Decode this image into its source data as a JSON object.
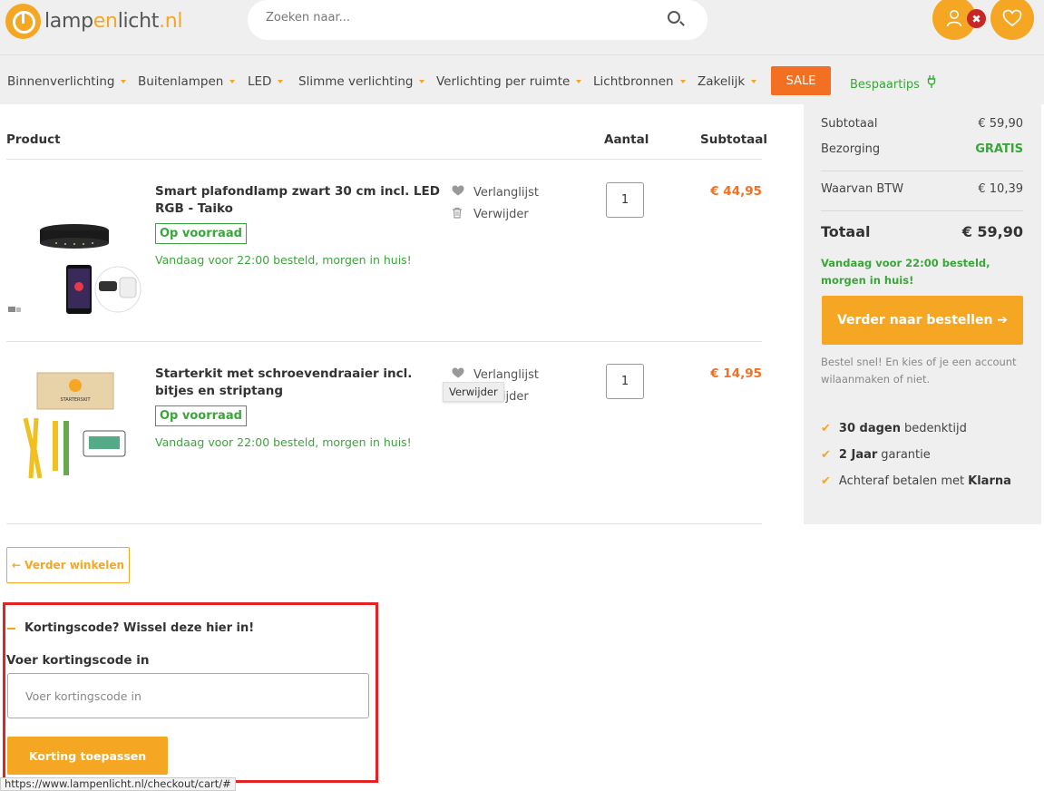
{
  "header": {
    "logo_pre": "lamp",
    "logo_mid": "en",
    "logo_post": "licht",
    "logo_tld": ".nl",
    "search_placeholder": "Zoeken naar...",
    "account_badge": "✖"
  },
  "nav": {
    "items": [
      "Binnenverlichting",
      "Buitenlampen",
      "LED",
      "Slimme verlichting",
      "Verlichting per ruimte",
      "Lichtbronnen",
      "Zakelijk"
    ],
    "sale": "SALE",
    "bespaartips": "Bespaartips"
  },
  "cart": {
    "headers": {
      "product": "Product",
      "quantity": "Aantal",
      "subtotal": "Subtotaal"
    },
    "items": [
      {
        "name": "Smart plafondlamp zwart 30 cm incl. LED RGB - Taiko",
        "stock": "Op voorraad",
        "delivery": "Vandaag voor 22:00 besteld, morgen in huis!",
        "wishlist": "Verlanglijst",
        "remove": "Verwijder",
        "qty": "1",
        "price": "€ 44,95"
      },
      {
        "name": "Starterkit met schroevendraaier incl. bitjes en striptang",
        "stock": "Op voorraad",
        "delivery": "Vandaag voor 22:00 besteld, morgen in huis!",
        "wishlist": "Verlanglijst",
        "remove": "Verwijder",
        "qty": "1",
        "price": "€ 14,95"
      }
    ],
    "tooltip": "Verwijder",
    "continue_shopping": "← Verder winkelen",
    "kit_label": "STARTERSKIT"
  },
  "coupon": {
    "title": "Kortingscode? Wissel deze hier in!",
    "label": "Voer kortingscode in",
    "placeholder": "Voer kortingscode in",
    "apply": "Korting toepassen"
  },
  "status_url": "https://www.lampenlicht.nl/checkout/cart/#",
  "summary": {
    "subtotal_label": "Subtotaal",
    "subtotal_value": "€ 59,90",
    "shipping_label": "Bezorging",
    "shipping_value": "GRATIS",
    "vat_label": "Waarvan BTW",
    "vat_value": "€ 10,39",
    "total_label": "Totaal",
    "total_value": "€ 59,90",
    "delivery_note": "Vandaag voor 22:00 besteld, morgen in huis!",
    "order_button": "Verder naar bestellen ➔",
    "account_note": "Bestel snel! En kies of je een account wilaanmaken of niet.",
    "usps": [
      {
        "bold": "30 dagen",
        "text": "bedenktijd"
      },
      {
        "bold": "2 Jaar",
        "text": "garantie"
      },
      {
        "bold": "",
        "text": "Achteraf betalen met",
        "bold_after": "Klarna"
      }
    ]
  },
  "colors": {
    "accent_orange": "#f5a623",
    "sale_orange": "#f36f21",
    "green": "#3aa63a",
    "highlight_red": "#e52222"
  }
}
